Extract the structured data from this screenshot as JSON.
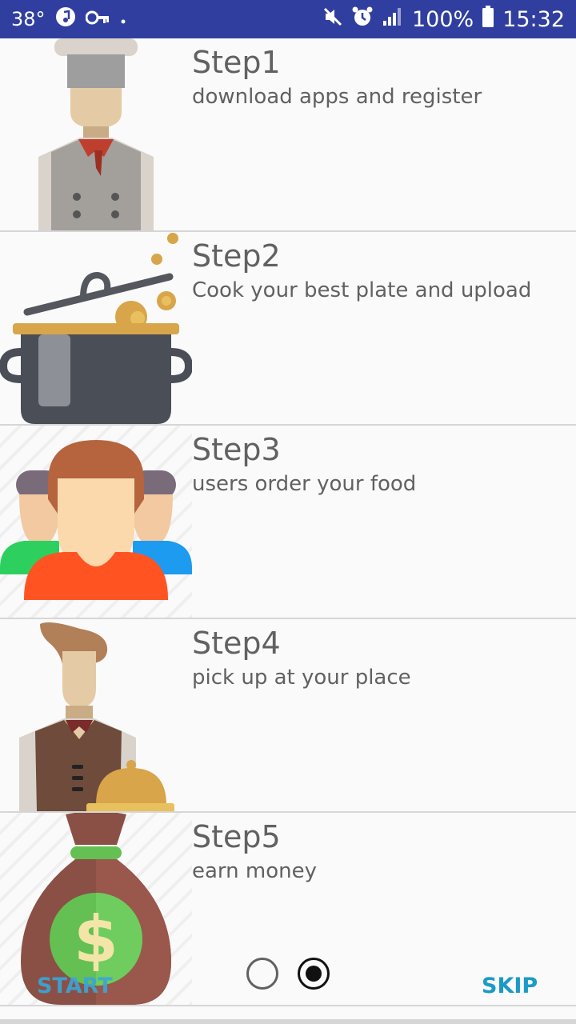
{
  "status_bar": {
    "temperature": "38°",
    "time": "15:32",
    "battery": "100%"
  },
  "steps": [
    {
      "title": "Step1",
      "desc": "download apps and register",
      "icon": "chef-icon"
    },
    {
      "title": "Step2",
      "desc": "Cook your best plate and upload",
      "icon": "cooking-pot-icon"
    },
    {
      "title": "Step3",
      "desc": "users order your food",
      "icon": "users-group-icon"
    },
    {
      "title": "Step4",
      "desc": "pick up at your place",
      "icon": "waiter-icon"
    },
    {
      "title": "Step5",
      "desc": "earn money",
      "icon": "money-bag-icon"
    }
  ],
  "footer": {
    "start_label": "START",
    "skip_label": "SKIP",
    "page_count": 2,
    "active_page": 2
  }
}
